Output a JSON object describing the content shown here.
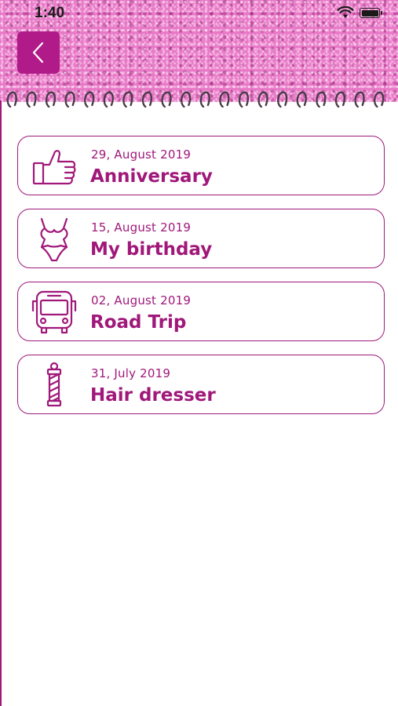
{
  "status_bar": {
    "time": "1:40"
  },
  "theme": {
    "accent": "#a0187a",
    "button": "#b11b89",
    "glitter": "#e879c7"
  },
  "events": [
    {
      "date": "29, August 2019",
      "title": "Anniversary",
      "icon": "thumbs-up-icon"
    },
    {
      "date": "15, August 2019",
      "title": "My birthday",
      "icon": "swimsuit-icon"
    },
    {
      "date": "02, August 2019",
      "title": "Road Trip",
      "icon": "bus-icon"
    },
    {
      "date": "31, July 2019",
      "title": "Hair dresser",
      "icon": "barber-pole-icon"
    }
  ]
}
